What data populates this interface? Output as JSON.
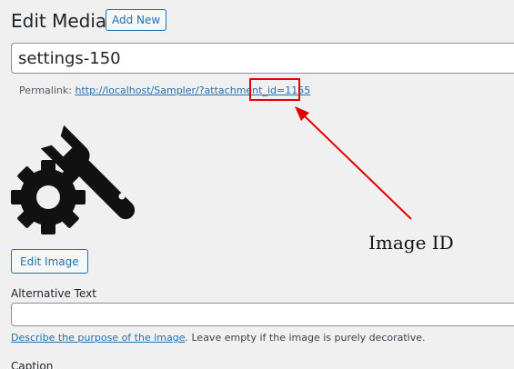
{
  "header": {
    "title": "Edit Media",
    "add_new_label": "Add New"
  },
  "title_field": {
    "value": "settings-150"
  },
  "permalink": {
    "label": "Permalink:",
    "url": "http://localhost/Sampler/?attachment_id=1155"
  },
  "annotation": {
    "label": "Image ID",
    "color": "#e00000"
  },
  "media": {
    "icon": "settings-icon"
  },
  "edit_image_label": "Edit Image",
  "alt_text": {
    "label": "Alternative Text",
    "value": "",
    "help_link": "Describe the purpose of the image",
    "help_text": ". Leave empty if the image is purely decorative."
  },
  "caption": {
    "label": "Caption"
  },
  "colors": {
    "accent": "#2271b1",
    "background": "#f0f0f1"
  }
}
